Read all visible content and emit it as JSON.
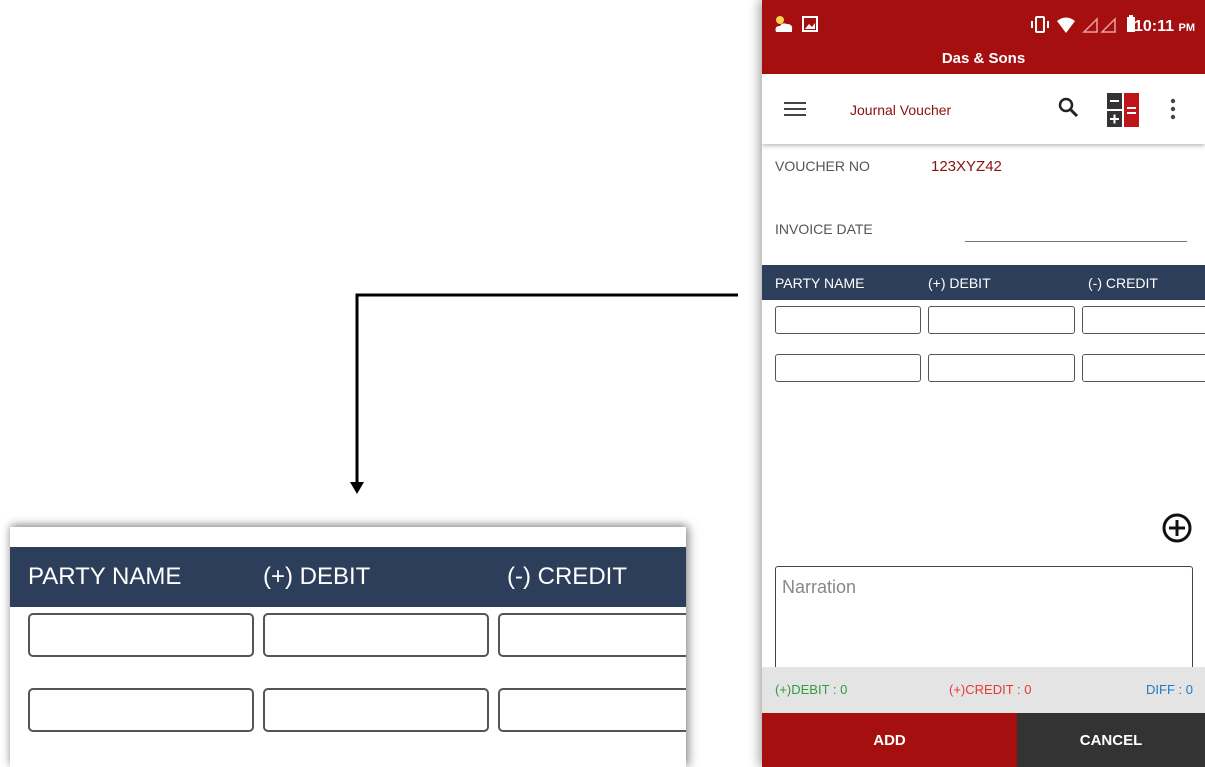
{
  "statusbar": {
    "time": "10:11",
    "ampm": "PM"
  },
  "app": {
    "company": "Das & Sons"
  },
  "toolbar": {
    "title": "Journal Voucher",
    "menu_icon": "hamburger-menu-icon",
    "search_icon": "search-icon",
    "calculator_icon": "calculator-icon",
    "more_icon": "more-vertical-icon"
  },
  "voucher": {
    "voucher_no_label": "VOUCHER NO",
    "voucher_no_value": "123XYZ42",
    "invoice_date_label": "INVOICE DATE",
    "invoice_date_value": ""
  },
  "table": {
    "columns": [
      "PARTY NAME",
      "(+) DEBIT",
      "(-) CREDIT"
    ],
    "rows": [
      {
        "party": "",
        "debit": "",
        "credit": ""
      },
      {
        "party": "",
        "debit": "",
        "credit": ""
      }
    ]
  },
  "narration": {
    "placeholder": "Narration"
  },
  "totals": {
    "debit": "(+)DEBIT : 0",
    "credit": "(+)CREDIT : 0",
    "diff": "DIFF : 0"
  },
  "buttons": {
    "add": "ADD",
    "cancel": "CANCEL"
  },
  "colors": {
    "brand_red": "#a50f0f",
    "header_navy": "#2c3e5a",
    "debit_green": "#2e9e3e",
    "credit_red": "#e53935",
    "diff_blue": "#1e7bc8"
  }
}
